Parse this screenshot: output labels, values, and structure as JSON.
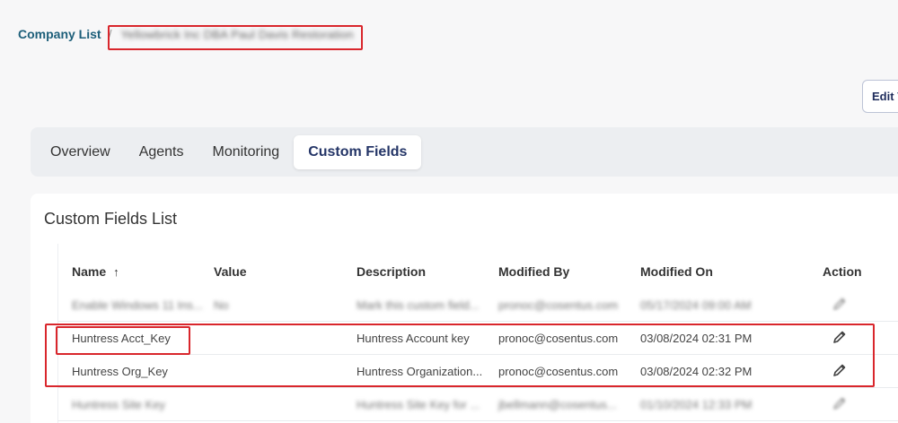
{
  "breadcrumb": {
    "link": "Company List",
    "separator": "/",
    "current": "Yellowbrick Inc DBA Paul Davis Restoration"
  },
  "header": {
    "edit_button_label": "Edit V"
  },
  "tabs": [
    {
      "label": "Overview",
      "active": false
    },
    {
      "label": "Agents",
      "active": false
    },
    {
      "label": "Monitoring",
      "active": false
    },
    {
      "label": "Custom Fields",
      "active": true
    }
  ],
  "card": {
    "title": "Custom Fields List"
  },
  "table": {
    "columns": [
      "Name",
      "Value",
      "Description",
      "Modified By",
      "Modified On",
      "Action"
    ],
    "sort_icon": "↑",
    "rows": [
      {
        "name": "Enable Windows 11 Ins...",
        "value": "No",
        "description": "Mark this custom field...",
        "modified_by": "pronoc@cosentus.com",
        "modified_on": "05/17/2024 09:00 AM",
        "blurred": true
      },
      {
        "name": "Huntress Acct_Key",
        "value": "",
        "description": "Huntress Account key",
        "modified_by": "pronoc@cosentus.com",
        "modified_on": "03/08/2024 02:31 PM",
        "blurred": false
      },
      {
        "name": "Huntress Org_Key",
        "value": "",
        "description": "Huntress Organization...",
        "modified_by": "pronoc@cosentus.com",
        "modified_on": "03/08/2024 02:32 PM",
        "blurred": false
      },
      {
        "name": "Huntress Site Key",
        "value": "",
        "description": "Huntress Site Key for ...",
        "modified_by": "jbellmann@cosentus...",
        "modified_on": "01/10/2024 12:33 PM",
        "blurred": true
      }
    ]
  },
  "colors": {
    "highlight": "#d9262c",
    "link": "#1d5f7a",
    "active_tab_text": "#243567"
  },
  "icons": {
    "edit": "pencil-icon",
    "sort": "arrow-up-icon"
  }
}
